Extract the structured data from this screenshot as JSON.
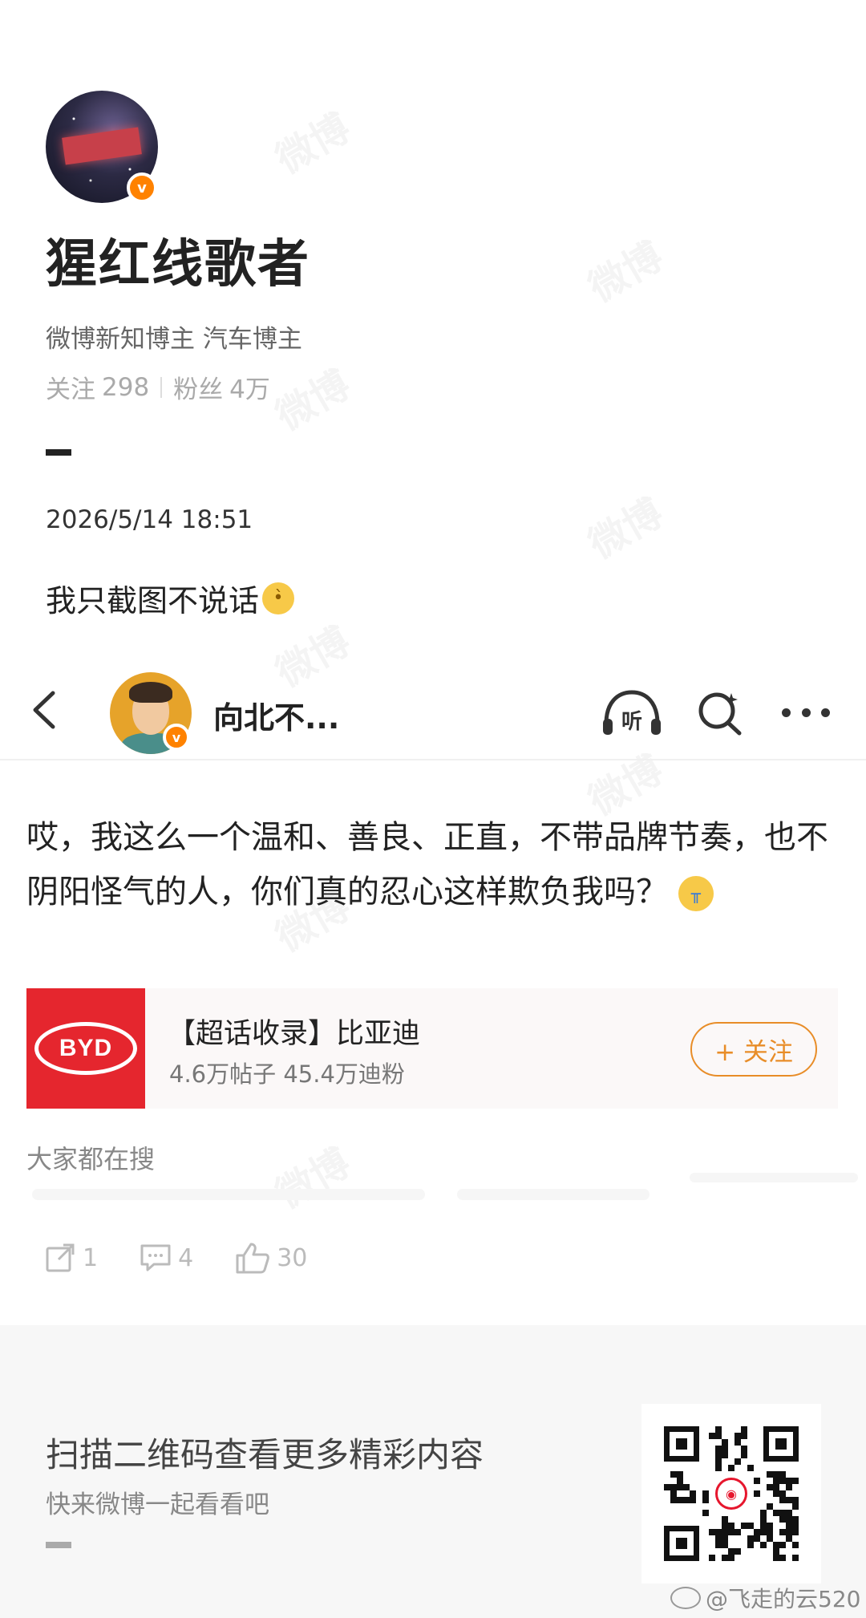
{
  "watermark_text": "微博",
  "post": {
    "author": "猩红线歌者",
    "tags": "微博新知博主 汽车博主",
    "following_label": "关注",
    "following_count": "298",
    "followers_label": "粉丝",
    "followers_count": "4万",
    "timestamp": "2026/5/14 18:51",
    "text": "我只截图不说话",
    "verified_badge": "v"
  },
  "embedded": {
    "author": "向北不...",
    "listen_label": "听",
    "verified_badge": "v",
    "post_text": "哎，我这么一个温和、善良、正直，不带品牌节奏，也不阴阳怪气的人，你们真的忍心这样欺负我吗？",
    "topic": {
      "logo_text": "BYD",
      "title": "【超话收录】比亚迪",
      "stats": "4.6万帖子 45.4万迪粉",
      "follow_label": "+ 关注"
    },
    "search_label": "大家都在搜",
    "actions": {
      "repost_count": "1",
      "comment_count": "4",
      "like_count": "30"
    }
  },
  "footer": {
    "title": "扫描二维码查看更多精彩内容",
    "subtitle": "快来微博一起看看吧",
    "credit": "@飞走的云520"
  },
  "colors": {
    "accent_orange": "#ff8200",
    "byd_red": "#e5262e",
    "follow_orange": "#e88d28"
  }
}
